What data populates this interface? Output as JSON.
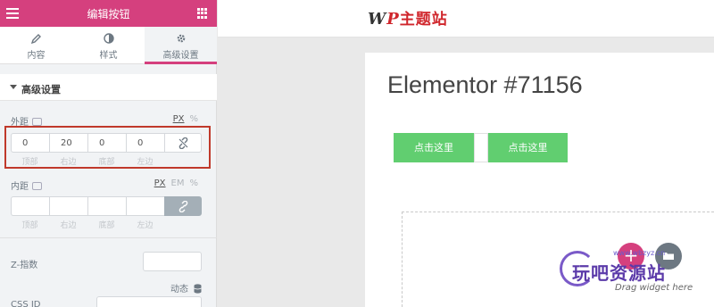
{
  "panel": {
    "title": "编辑按钮",
    "tabs": [
      {
        "label": "内容",
        "icon": "pencil-icon"
      },
      {
        "label": "样式",
        "icon": "half-circle-icon"
      },
      {
        "label": "高级设置",
        "icon": "gear-icon",
        "active": true
      }
    ],
    "section_title": "高级设置",
    "margin": {
      "label": "外距",
      "units": [
        "PX",
        "%"
      ],
      "active_unit": "PX",
      "values": [
        "0",
        "20",
        "0",
        "0"
      ],
      "sub_labels": [
        "顶部",
        "右边",
        "底部",
        "左边"
      ],
      "linked": false
    },
    "padding": {
      "label": "内距",
      "units": [
        "PX",
        "EM",
        "%"
      ],
      "active_unit": "PX",
      "values": [
        "",
        "",
        "",
        ""
      ],
      "sub_labels": [
        "顶部",
        "右边",
        "底部",
        "左边"
      ],
      "linked": true
    },
    "z_index_label": "Z-指数",
    "dynamic_label": "动态",
    "css_id_label": "CSS ID"
  },
  "topbar": {
    "logo_w": "W",
    "logo_p": "P",
    "logo_rest": "主题站"
  },
  "canvas": {
    "heading": "Elementor #71156",
    "buttons": [
      "点击这里",
      "点击这里"
    ],
    "add_symbol": "+",
    "drag_text": "Drag widget here"
  },
  "watermark": {
    "text": "玩吧资源站",
    "url": "www.wbzyz.cn"
  },
  "colors": {
    "brand": "#d5407e",
    "button_green": "#61ce70",
    "highlight_red": "#c0392b"
  }
}
